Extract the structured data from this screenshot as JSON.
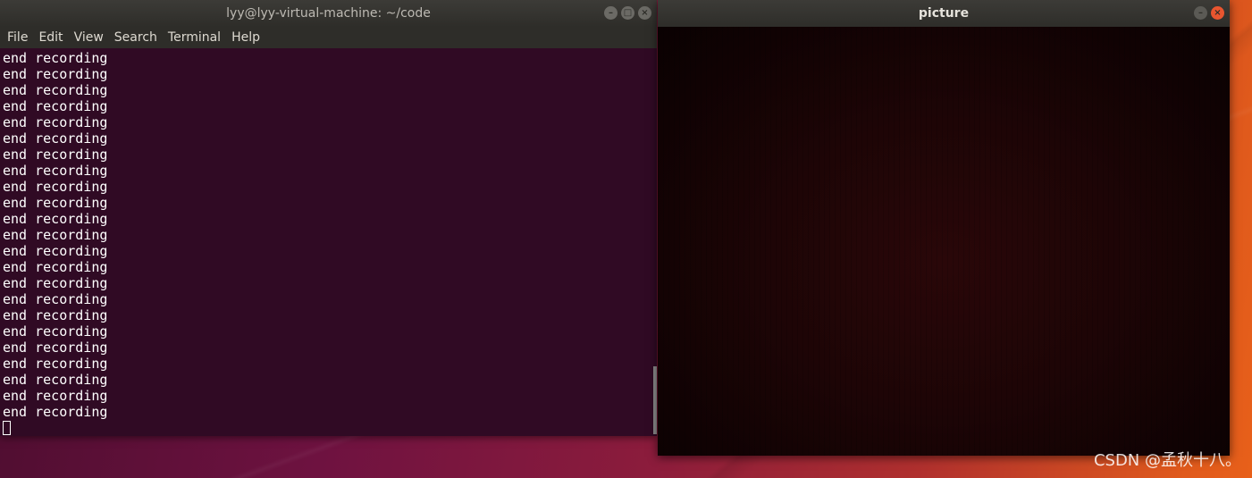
{
  "terminal": {
    "title": "lyy@lyy-virtual-machine: ~/code",
    "menu": [
      "File",
      "Edit",
      "View",
      "Search",
      "Terminal",
      "Help"
    ],
    "lines": [
      "end recording",
      "end recording",
      "end recording",
      "end recording",
      "end recording",
      "end recording",
      "end recording",
      "end recording",
      "end recording",
      "end recording",
      "end recording",
      "end recording",
      "end recording",
      "end recording",
      "end recording",
      "end recording",
      "end recording",
      "end recording",
      "end recording",
      "end recording",
      "end recording",
      "end recording",
      "end recording"
    ],
    "window_buttons": [
      "minimize-icon",
      "maximize-icon",
      "close-icon"
    ]
  },
  "picture": {
    "title": "picture",
    "window_buttons": [
      "minimize-icon",
      "close-icon"
    ]
  },
  "watermark": "CSDN @孟秋十八。",
  "colors": {
    "terminal_bg": "#300a24",
    "titlebar": "#2e2d29",
    "close_button": "#e9552f",
    "desktop_accent": "#e8601a"
  }
}
